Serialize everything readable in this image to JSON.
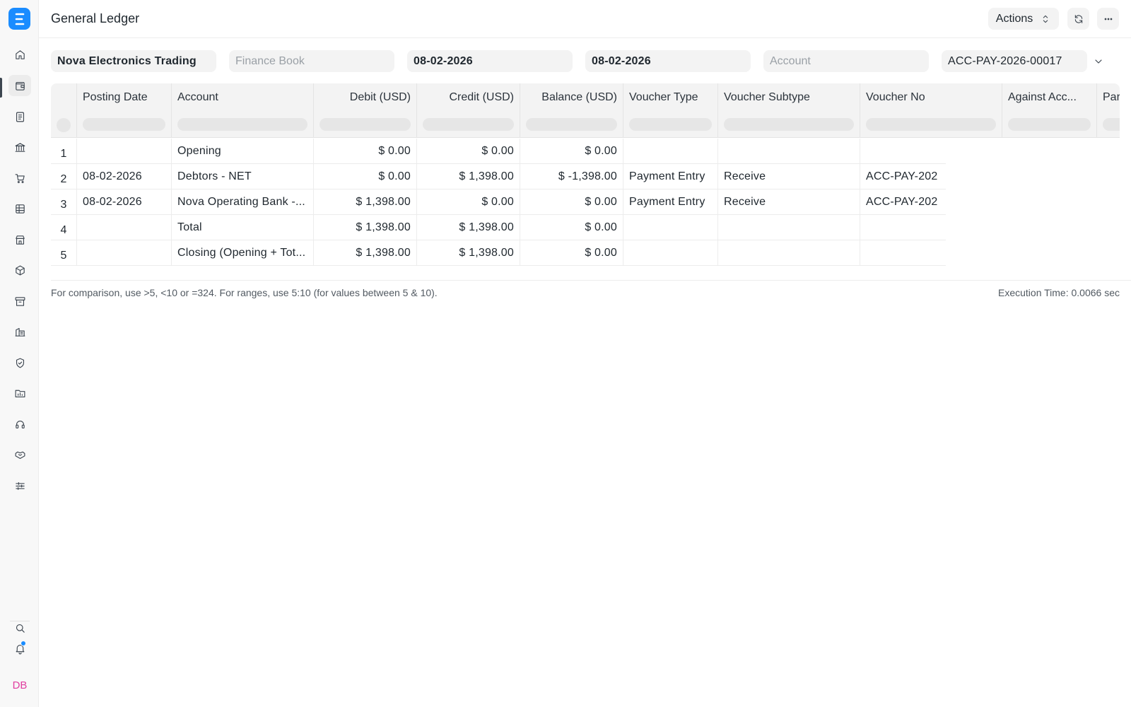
{
  "sidebar": {
    "logo_letter": "E",
    "avatar": "DB",
    "icons": [
      "home-icon",
      "wallet-icon",
      "document-icon",
      "bank-icon",
      "cart-icon",
      "table-icon",
      "store-icon",
      "package-icon",
      "archive-icon",
      "building-icon",
      "shield-icon",
      "folder-chart-icon",
      "headset-icon",
      "handshake-icon",
      "sliders-icon"
    ]
  },
  "header": {
    "title": "General Ledger",
    "actions_label": "Actions"
  },
  "filters": {
    "company": "Nova Electronics Trading",
    "finance_book_placeholder": "Finance Book",
    "from_date": "08-02-2026",
    "to_date": "08-02-2026",
    "account_placeholder": "Account",
    "voucher_no": "ACC-PAY-2026-00017"
  },
  "table": {
    "columns": [
      "Posting Date",
      "Account",
      "Debit (USD)",
      "Credit (USD)",
      "Balance (USD)",
      "Voucher Type",
      "Voucher Subtype",
      "Voucher No",
      "Against Acc...",
      "Par"
    ],
    "rows": [
      {
        "idx": "1",
        "posting_date": "",
        "account": "Opening",
        "debit": "$ 0.00",
        "credit": "$ 0.00",
        "balance": "$ 0.00",
        "voucher_type": "",
        "voucher_subtype": "",
        "voucher_no": ""
      },
      {
        "idx": "2",
        "posting_date": "08-02-2026",
        "account": "Debtors - NET",
        "debit": "$ 0.00",
        "credit": "$ 1,398.00",
        "balance": "$ -1,398.00",
        "voucher_type": "Payment Entry",
        "voucher_subtype": "Receive",
        "voucher_no": "ACC-PAY-202"
      },
      {
        "idx": "3",
        "posting_date": "08-02-2026",
        "account": "Nova Operating Bank -...",
        "debit": "$ 1,398.00",
        "credit": "$ 0.00",
        "balance": "$ 0.00",
        "voucher_type": "Payment Entry",
        "voucher_subtype": "Receive",
        "voucher_no": "ACC-PAY-202"
      },
      {
        "idx": "4",
        "posting_date": "",
        "account": "Total",
        "debit": "$ 1,398.00",
        "credit": "$ 1,398.00",
        "balance": "$ 0.00",
        "voucher_type": "",
        "voucher_subtype": "",
        "voucher_no": ""
      },
      {
        "idx": "5",
        "posting_date": "",
        "account": "Closing (Opening + Tot...",
        "debit": "$ 1,398.00",
        "credit": "$ 1,398.00",
        "balance": "$ 0.00",
        "voucher_type": "",
        "voucher_subtype": "",
        "voucher_no": ""
      }
    ]
  },
  "footer": {
    "note": "For comparison, use >5, <10 or =324. For ranges, use 5:10 (for values between 5 & 10).",
    "execution_time": "Execution Time: 0.0066 sec"
  }
}
